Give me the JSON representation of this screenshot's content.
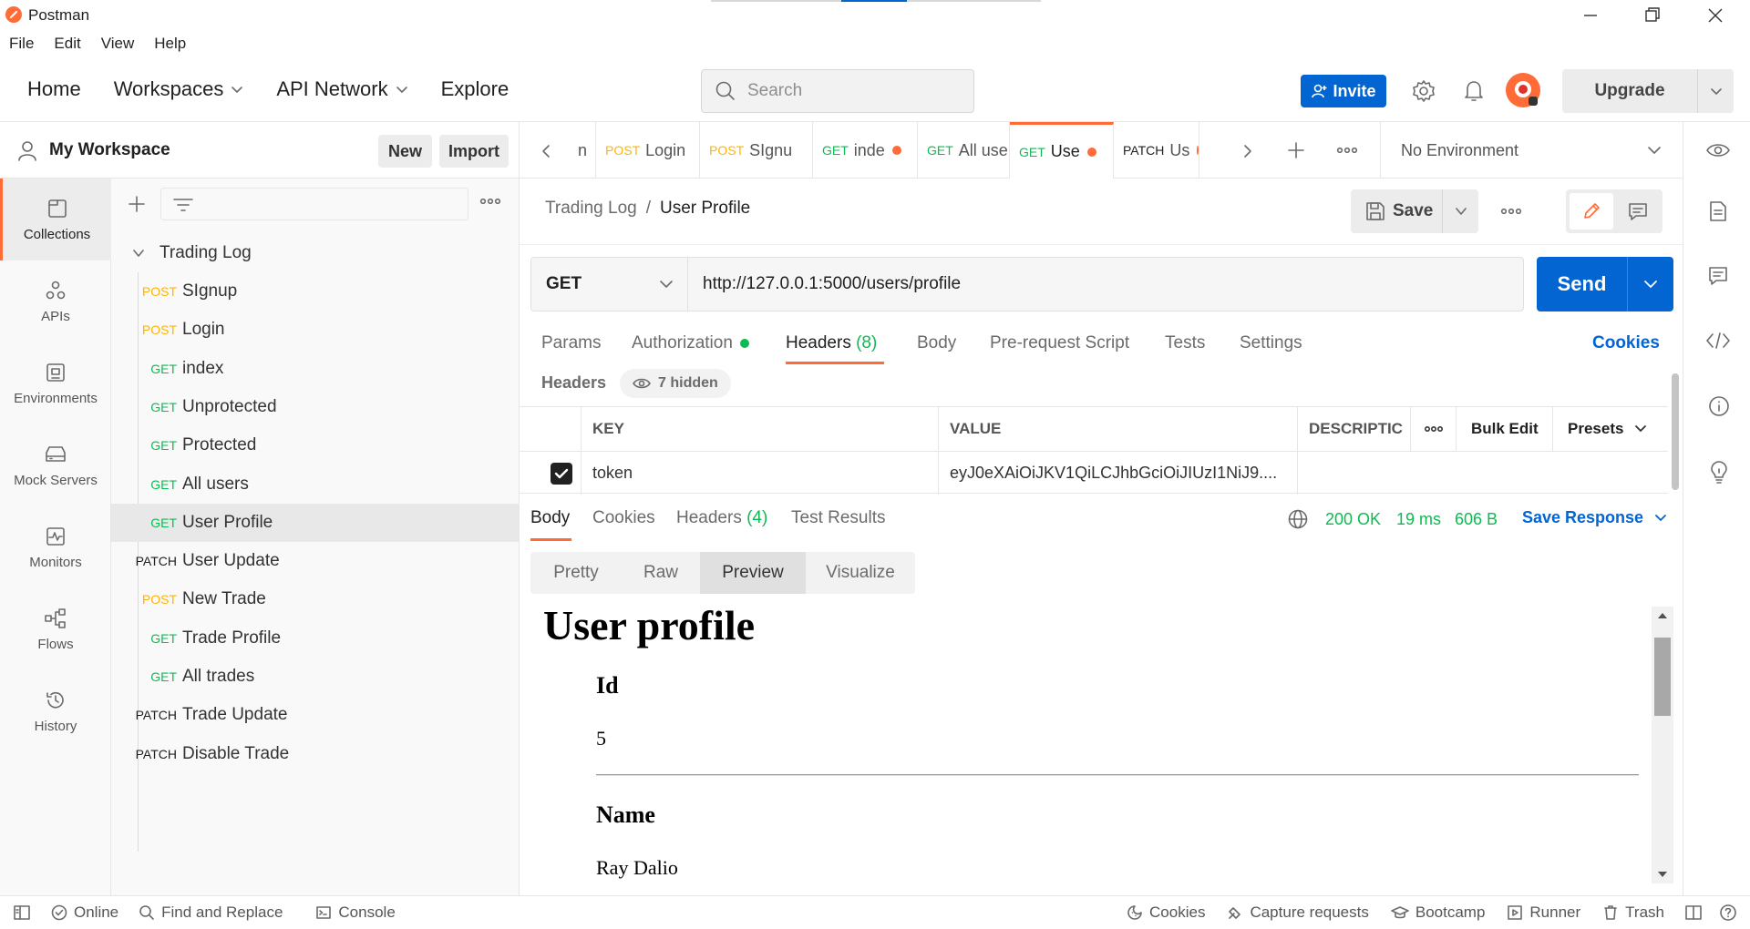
{
  "app": {
    "title": "Postman"
  },
  "menu": [
    "File",
    "Edit",
    "View",
    "Help"
  ],
  "header": {
    "nav": {
      "home": "Home",
      "workspaces": "Workspaces",
      "api_network": "API Network",
      "explore": "Explore"
    },
    "search_placeholder": "Search",
    "invite": "Invite",
    "upgrade": "Upgrade"
  },
  "workspace": {
    "name": "My Workspace",
    "new_label": "New",
    "import_label": "Import"
  },
  "rail": {
    "collections": "Collections",
    "apis": "APIs",
    "environments": "Environments",
    "mock_servers": "Mock Servers",
    "monitors": "Monitors",
    "flows": "Flows",
    "history": "History"
  },
  "collection": {
    "name": "Trading Log",
    "requests": [
      {
        "method": "POST",
        "name": "SIgnup"
      },
      {
        "method": "POST",
        "name": "Login"
      },
      {
        "method": "GET",
        "name": "index"
      },
      {
        "method": "GET",
        "name": "Unprotected"
      },
      {
        "method": "GET",
        "name": "Protected"
      },
      {
        "method": "GET",
        "name": "All users"
      },
      {
        "method": "GET",
        "name": "User Profile"
      },
      {
        "method": "PATCH",
        "name": "User Update"
      },
      {
        "method": "POST",
        "name": "New Trade"
      },
      {
        "method": "GET",
        "name": "Trade Profile"
      },
      {
        "method": "GET",
        "name": "All trades"
      },
      {
        "method": "PATCH",
        "name": "Trade Update"
      },
      {
        "method": "PATCH",
        "name": "Disable Trade"
      }
    ]
  },
  "tabs": [
    {
      "method": "",
      "name": "n"
    },
    {
      "method": "POST",
      "name": "Login"
    },
    {
      "method": "POST",
      "name": "SIgnu"
    },
    {
      "method": "GET",
      "name": "inde"
    },
    {
      "method": "GET",
      "name": "All use"
    },
    {
      "method": "GET",
      "name": "Use"
    },
    {
      "method": "PATCH",
      "name": "Us"
    }
  ],
  "environment": "No Environment",
  "breadcrumb": {
    "parent": "Trading Log",
    "separator": "/",
    "current": "User Profile"
  },
  "save_label": "Save",
  "request": {
    "method": "GET",
    "url": "http://127.0.0.1:5000/users/profile",
    "send_label": "Send"
  },
  "request_tabs": {
    "params": "Params",
    "authorization": "Authorization",
    "headers": "Headers",
    "headers_count": "(8)",
    "body": "Body",
    "pre_request": "Pre-request Script",
    "tests": "Tests",
    "settings": "Settings",
    "cookies": "Cookies"
  },
  "headers_section": {
    "title": "Headers",
    "hidden": "7 hidden"
  },
  "header_table": {
    "key_col": "KEY",
    "value_col": "VALUE",
    "desc_col": "DESCRIPTIC",
    "bulk_edit": "Bulk Edit",
    "presets": "Presets",
    "rows": [
      {
        "checked": true,
        "key": "token",
        "value": "eyJ0eXAiOiJKV1QiLCJhbGciOiJIUzI1NiJ9...."
      }
    ]
  },
  "response_tabs": {
    "body": "Body",
    "cookies": "Cookies",
    "headers": "Headers",
    "headers_count": "(4)",
    "test_results": "Test Results"
  },
  "response_status": {
    "status": "200 OK",
    "time": "19 ms",
    "size": "606 B",
    "save": "Save Response"
  },
  "view_modes": [
    "Pretty",
    "Raw",
    "Preview",
    "Visualize"
  ],
  "preview": {
    "title": "User profile",
    "fields": [
      {
        "label": "Id",
        "value": "5"
      },
      {
        "label": "Name",
        "value": "Ray Dalio"
      }
    ]
  },
  "statusbar": {
    "online": "Online",
    "find_replace": "Find and Replace",
    "console": "Console",
    "cookies": "Cookies",
    "capture": "Capture requests",
    "bootcamp": "Bootcamp",
    "runner": "Runner",
    "trash": "Trash"
  },
  "colors": {
    "accent": "#ff6c37",
    "primary": "#0265d2",
    "get": "#0cbb52",
    "post": "#ffb400",
    "success": "#0cbb52"
  }
}
